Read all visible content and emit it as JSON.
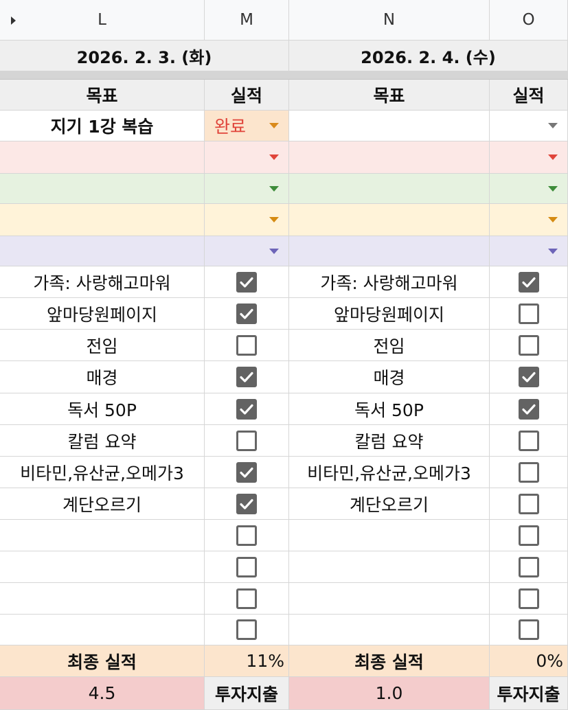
{
  "columns": [
    "L",
    "M",
    "N",
    "O"
  ],
  "days": [
    {
      "date": "2026. 2. 3. (화)",
      "goal_header": "목표",
      "result_header": "실적",
      "main_goal": "지기 1강 복습",
      "main_status": "완료",
      "habits": [
        {
          "label": "가족: 사랑해고마워",
          "checked": true
        },
        {
          "label": "앞마당원페이지",
          "checked": true
        },
        {
          "label": "전임",
          "checked": false
        },
        {
          "label": "매경",
          "checked": true
        },
        {
          "label": "독서 50P",
          "checked": true
        },
        {
          "label": "칼럼 요약",
          "checked": false
        },
        {
          "label": "비타민,유산균,오메가3",
          "checked": true
        },
        {
          "label": "계단오르기",
          "checked": true
        },
        {
          "label": "",
          "checked": false
        },
        {
          "label": "",
          "checked": false
        },
        {
          "label": "",
          "checked": false
        },
        {
          "label": "",
          "checked": false
        }
      ],
      "final_label": "최종 실적",
      "final_value": "11%",
      "score": "4.5",
      "invest_label": "투자지출"
    },
    {
      "date": "2026. 2. 4. (수)",
      "goal_header": "목표",
      "result_header": "실적",
      "main_goal": "",
      "main_status": "",
      "habits": [
        {
          "label": "가족: 사랑해고마워",
          "checked": true
        },
        {
          "label": "앞마당원페이지",
          "checked": false
        },
        {
          "label": "전임",
          "checked": false
        },
        {
          "label": "매경",
          "checked": true
        },
        {
          "label": "독서 50P",
          "checked": true
        },
        {
          "label": "칼럼 요약",
          "checked": false
        },
        {
          "label": "비타민,유산균,오메가3",
          "checked": false
        },
        {
          "label": "계단오르기",
          "checked": false
        },
        {
          "label": "",
          "checked": false
        },
        {
          "label": "",
          "checked": false
        },
        {
          "label": "",
          "checked": false
        },
        {
          "label": "",
          "checked": false
        }
      ],
      "final_label": "최종 실적",
      "final_value": "0%",
      "score": "1.0",
      "invest_label": "투자지출"
    }
  ],
  "colors": {
    "status_text": "#e0443a",
    "row_orange": "#fce5cd",
    "row_red": "#fce8e6",
    "row_green": "#e6f2e0",
    "row_yellow": "#fff3d9",
    "row_purple": "#e8e6f4",
    "score_bg": "#f4cccc",
    "checkbox_on": "#636363"
  }
}
